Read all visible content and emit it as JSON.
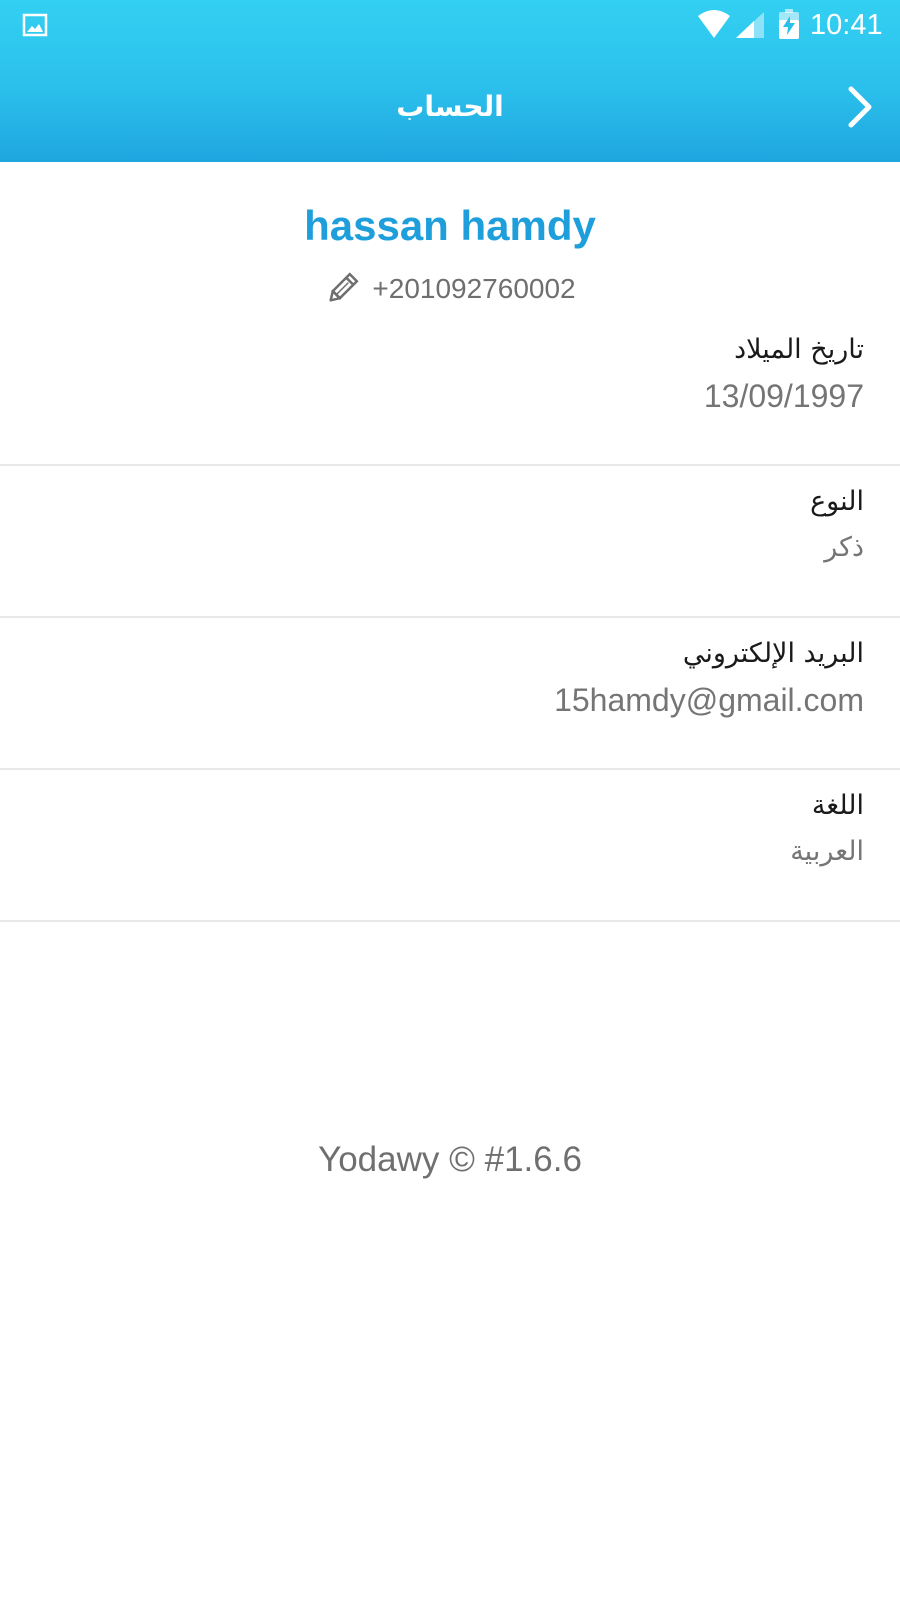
{
  "status_bar": {
    "time": "10:41",
    "icons": [
      "gallery-icon",
      "wifi-icon",
      "signal-icon",
      "battery-charging-icon"
    ]
  },
  "app_bar": {
    "title": "الحساب",
    "back_icon": "chevron-right-icon"
  },
  "profile": {
    "name": "hassan hamdy",
    "phone": "+201092760002",
    "edit_icon": "pencil-icon"
  },
  "fields": [
    {
      "label": "تاريخ الميلاد",
      "value": "13/09/1997"
    },
    {
      "label": "النوع",
      "value": "ذكر"
    },
    {
      "label": "البريد الإلكتروني",
      "value": "15hamdy@gmail.com"
    },
    {
      "label": "اللغة",
      "value": "العربية"
    }
  ],
  "footer": {
    "version": "Yodawy © #1.6.6"
  },
  "colors": {
    "header_top": "#33d0f2",
    "header_bottom": "#1ea6df",
    "accent": "#1e9fdb",
    "label_text": "#1a1a1a",
    "value_text": "#757575",
    "divider": "#e8e8e8"
  }
}
